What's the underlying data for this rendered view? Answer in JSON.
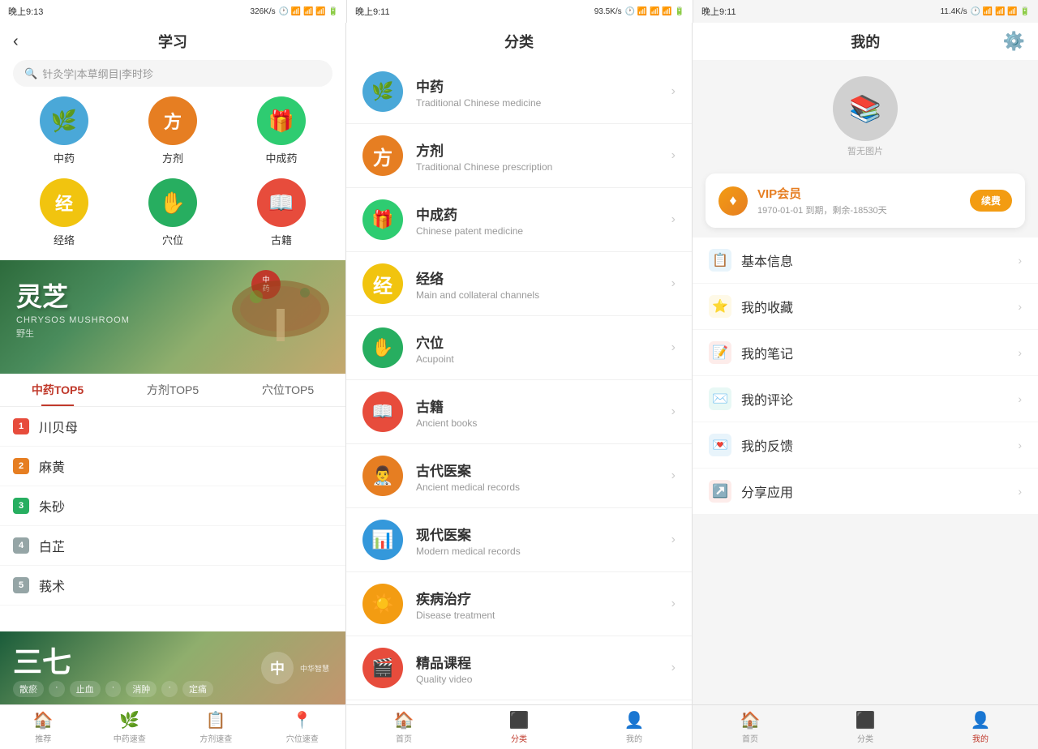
{
  "panels": {
    "left": {
      "status": "晚上9:13",
      "status_right": "326K/s",
      "title": "学习",
      "search_placeholder": "针灸学|本草纲目|李时珍",
      "icons": [
        {
          "id": "zhongyao",
          "label": "中药",
          "color": "#4aa8d8",
          "emoji": "🌿"
        },
        {
          "id": "fangji",
          "label": "方剂",
          "color": "#e67e22",
          "emoji": "方"
        },
        {
          "id": "zhongchengyao",
          "label": "中成药",
          "color": "#2ecc71",
          "emoji": "🎁"
        },
        {
          "id": "jingluo",
          "label": "经络",
          "color": "#f1c40f",
          "emoji": "经"
        },
        {
          "id": "xuewei",
          "label": "穴位",
          "color": "#27ae60",
          "emoji": "✋"
        },
        {
          "id": "guji",
          "label": "古籍",
          "color": "#e74c3c",
          "emoji": "📖"
        }
      ],
      "tabs": [
        {
          "id": "zhongyao-top5",
          "label": "中药TOP5",
          "active": true
        },
        {
          "id": "fangji-top5",
          "label": "方剂TOP5",
          "active": false
        },
        {
          "id": "xuewei-top5",
          "label": "穴位TOP5",
          "active": false
        }
      ],
      "list": [
        {
          "rank": 1,
          "name": "川贝母"
        },
        {
          "rank": 2,
          "name": "麻黄"
        },
        {
          "rank": 3,
          "name": "朱砂"
        },
        {
          "rank": 4,
          "name": "白芷"
        },
        {
          "rank": 5,
          "name": "莪术"
        }
      ],
      "banner2": {
        "title": "三七",
        "tags": [
          "散瘀",
          "止血",
          "消肿",
          "定痛"
        ]
      },
      "bottom_nav": [
        {
          "id": "home",
          "label": "推荐",
          "icon": "🏠",
          "active": false
        },
        {
          "id": "herb",
          "label": "中药速查",
          "icon": "🌿",
          "active": false
        },
        {
          "id": "formula",
          "label": "方剂速查",
          "icon": "📋",
          "active": false
        },
        {
          "id": "acupoint",
          "label": "穴位速查",
          "icon": "📍",
          "active": false
        }
      ]
    },
    "middle": {
      "status": "晚上9:11",
      "status_right": "93.5K/s",
      "title": "分类",
      "categories": [
        {
          "id": "zhongyao",
          "name": "中药",
          "sub": "Traditional Chinese medicine",
          "color": "#4aa8d8",
          "emoji": "🌿"
        },
        {
          "id": "fangji",
          "name": "方剂",
          "sub": "Traditional Chinese prescription",
          "color": "#e67e22",
          "emoji": "方"
        },
        {
          "id": "zhongchengyao",
          "name": "中成药",
          "sub": "Chinese patent medicine",
          "color": "#2ecc71",
          "emoji": "🎁"
        },
        {
          "id": "jingluo",
          "name": "经络",
          "sub": "Main and collateral channels",
          "color": "#f1c40f",
          "emoji": "经"
        },
        {
          "id": "xuewei",
          "name": "穴位",
          "sub": "Acupoint",
          "color": "#27ae60",
          "emoji": "✋"
        },
        {
          "id": "guji",
          "name": "古籍",
          "sub": "Ancient books",
          "color": "#e74c3c",
          "emoji": "📖"
        },
        {
          "id": "gudai-yian",
          "name": "古代医案",
          "sub": "Ancient medical records",
          "color": "#e67e22",
          "emoji": "👨‍⚕️"
        },
        {
          "id": "xiandai-yian",
          "name": "现代医案",
          "sub": "Modern medical records",
          "color": "#3498db",
          "emoji": "📊"
        },
        {
          "id": "jibing-zhiliao",
          "name": "疾病治疗",
          "sub": "Disease treatment",
          "color": "#f39c12",
          "emoji": "☀️"
        },
        {
          "id": "jingpin-kecheng",
          "name": "精品课程",
          "sub": "Quality video",
          "color": "#e74c3c",
          "emoji": "🎬"
        }
      ],
      "bottom_nav": [
        {
          "id": "home",
          "label": "首页",
          "icon": "🏠",
          "active": false
        },
        {
          "id": "category",
          "label": "分类",
          "icon": "⬛",
          "active": true
        },
        {
          "id": "mine",
          "label": "我的",
          "icon": "👤",
          "active": false
        }
      ]
    },
    "right": {
      "status": "晚上9:11",
      "status_right": "11.4K/s",
      "title": "我的",
      "avatar_label": "暂无图片",
      "vip": {
        "title": "VIP会员",
        "expire": "1970-01-01 到期，剩余-18530天",
        "btn": "续费"
      },
      "menu_items": [
        {
          "id": "basic-info",
          "label": "基本信息",
          "icon": "📋",
          "icon_bg": "#3498db"
        },
        {
          "id": "my-collection",
          "label": "我的收藏",
          "icon": "⭐",
          "icon_bg": "#f39c12"
        },
        {
          "id": "my-notes",
          "label": "我的笔记",
          "icon": "📝",
          "icon_bg": "#e74c3c"
        },
        {
          "id": "my-comments",
          "label": "我的评论",
          "icon": "✉️",
          "icon_bg": "#2ecc71"
        },
        {
          "id": "my-feedback",
          "label": "我的反馈",
          "icon": "💌",
          "icon_bg": "#3498db"
        },
        {
          "id": "share-app",
          "label": "分享应用",
          "icon": "↗️",
          "icon_bg": "#e74c3c"
        }
      ],
      "bottom_nav": [
        {
          "id": "home",
          "label": "首页",
          "icon": "🏠",
          "active": false
        },
        {
          "id": "category",
          "label": "分类",
          "icon": "⬛",
          "active": false
        },
        {
          "id": "mine",
          "label": "我的",
          "icon": "👤",
          "active": true
        }
      ]
    }
  }
}
